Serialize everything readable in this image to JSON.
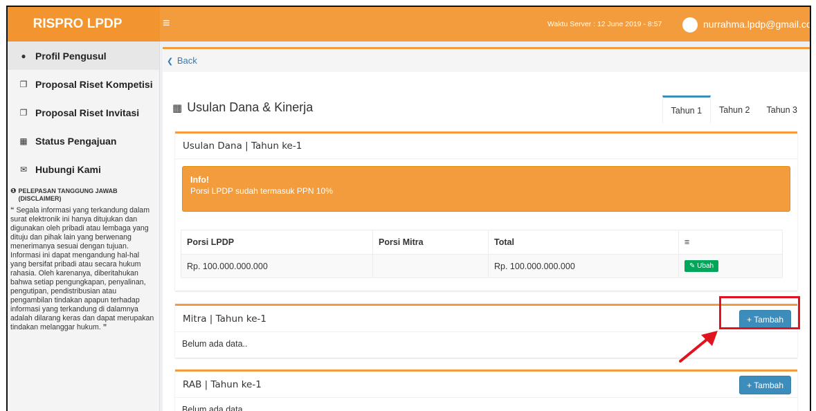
{
  "app": {
    "brand": "RISPRO LPDP",
    "server_time": "Waktu Server : 12 June 2019 - 8:57",
    "user_email": "nurrahma.lpdp@gmail.com"
  },
  "sidebar": {
    "items": [
      {
        "label": "Profil Pengusul",
        "icon": "users-icon"
      },
      {
        "label": "Proposal Riset Kompetisi",
        "icon": "copy-icon"
      },
      {
        "label": "Proposal Riset Invitasi",
        "icon": "copy-icon"
      },
      {
        "label": "Status Pengajuan",
        "icon": "grid-icon"
      },
      {
        "label": "Hubungi Kami",
        "icon": "envelope-icon"
      }
    ],
    "disclaimer_title": "PELEPASAN TANGGUNG JAWAB (DISCLAIMER)",
    "disclaimer_text": "Segala informasi yang terkandung dalam surat elektronik ini hanya ditujukan dan digunakan oleh pribadi atau lembaga yang dituju dan pihak lain yang berwenang menerimanya sesuai dengan tujuan. Informasi ini dapat mengandung hal-hal yang bersifat pribadi atau secara hukum rahasia. Oleh karenanya, diberitahukan bahwa setiap pengungkapan, penyalinan, pengutipan, pendistribusian atau pengambilan tindakan apapun terhadap informasi yang terkandung di dalamnya adalah dilarang keras dan dapat merupakan tindakan melanggar hukum."
  },
  "main": {
    "back_label": "Back",
    "title": "Usulan Dana & Kinerja",
    "tabs": [
      {
        "label": "Tahun 1",
        "active": true
      },
      {
        "label": "Tahun 2",
        "active": false
      },
      {
        "label": "Tahun 3",
        "active": false
      }
    ],
    "usulan": {
      "header": "Usulan Dana | Tahun ke-1",
      "info_title": "Info!",
      "info_message": "Porsi LPDP sudah termasuk PPN 10%",
      "columns": [
        "Porsi LPDP",
        "Porsi Mitra",
        "Total",
        "≡"
      ],
      "row": {
        "porsi_lpdp": "Rp. 100.000.000.000",
        "porsi_mitra": "",
        "total": "Rp. 100.000.000.000",
        "action": "Ubah"
      }
    },
    "mitra": {
      "header": "Mitra | Tahun ke-1",
      "add_label": "Tambah",
      "empty": "Belum ada data.."
    },
    "rab": {
      "header": "RAB | Tahun ke-1",
      "add_label": "Tambah",
      "empty": "Belum ada data.."
    }
  },
  "colors": {
    "accent": "#f39c3d",
    "primary_button": "#3c8dbc",
    "success_button": "#00a65a",
    "annotation": "#e0141e"
  }
}
